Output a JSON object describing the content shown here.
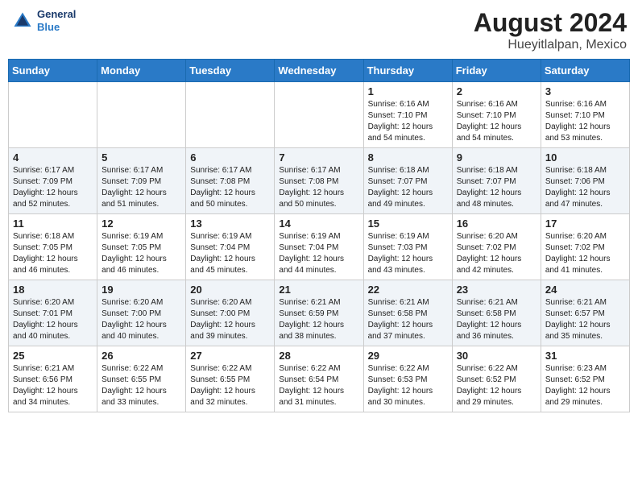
{
  "header": {
    "logo_general": "General",
    "logo_blue": "Blue",
    "title": "August 2024",
    "subtitle": "Hueyitlalpan, Mexico"
  },
  "days_of_week": [
    "Sunday",
    "Monday",
    "Tuesday",
    "Wednesday",
    "Thursday",
    "Friday",
    "Saturday"
  ],
  "weeks": [
    [
      {
        "day": "",
        "info": ""
      },
      {
        "day": "",
        "info": ""
      },
      {
        "day": "",
        "info": ""
      },
      {
        "day": "",
        "info": ""
      },
      {
        "day": "1",
        "info": "Sunrise: 6:16 AM\nSunset: 7:10 PM\nDaylight: 12 hours\nand 54 minutes."
      },
      {
        "day": "2",
        "info": "Sunrise: 6:16 AM\nSunset: 7:10 PM\nDaylight: 12 hours\nand 54 minutes."
      },
      {
        "day": "3",
        "info": "Sunrise: 6:16 AM\nSunset: 7:10 PM\nDaylight: 12 hours\nand 53 minutes."
      }
    ],
    [
      {
        "day": "4",
        "info": "Sunrise: 6:17 AM\nSunset: 7:09 PM\nDaylight: 12 hours\nand 52 minutes."
      },
      {
        "day": "5",
        "info": "Sunrise: 6:17 AM\nSunset: 7:09 PM\nDaylight: 12 hours\nand 51 minutes."
      },
      {
        "day": "6",
        "info": "Sunrise: 6:17 AM\nSunset: 7:08 PM\nDaylight: 12 hours\nand 50 minutes."
      },
      {
        "day": "7",
        "info": "Sunrise: 6:17 AM\nSunset: 7:08 PM\nDaylight: 12 hours\nand 50 minutes."
      },
      {
        "day": "8",
        "info": "Sunrise: 6:18 AM\nSunset: 7:07 PM\nDaylight: 12 hours\nand 49 minutes."
      },
      {
        "day": "9",
        "info": "Sunrise: 6:18 AM\nSunset: 7:07 PM\nDaylight: 12 hours\nand 48 minutes."
      },
      {
        "day": "10",
        "info": "Sunrise: 6:18 AM\nSunset: 7:06 PM\nDaylight: 12 hours\nand 47 minutes."
      }
    ],
    [
      {
        "day": "11",
        "info": "Sunrise: 6:18 AM\nSunset: 7:05 PM\nDaylight: 12 hours\nand 46 minutes."
      },
      {
        "day": "12",
        "info": "Sunrise: 6:19 AM\nSunset: 7:05 PM\nDaylight: 12 hours\nand 46 minutes."
      },
      {
        "day": "13",
        "info": "Sunrise: 6:19 AM\nSunset: 7:04 PM\nDaylight: 12 hours\nand 45 minutes."
      },
      {
        "day": "14",
        "info": "Sunrise: 6:19 AM\nSunset: 7:04 PM\nDaylight: 12 hours\nand 44 minutes."
      },
      {
        "day": "15",
        "info": "Sunrise: 6:19 AM\nSunset: 7:03 PM\nDaylight: 12 hours\nand 43 minutes."
      },
      {
        "day": "16",
        "info": "Sunrise: 6:20 AM\nSunset: 7:02 PM\nDaylight: 12 hours\nand 42 minutes."
      },
      {
        "day": "17",
        "info": "Sunrise: 6:20 AM\nSunset: 7:02 PM\nDaylight: 12 hours\nand 41 minutes."
      }
    ],
    [
      {
        "day": "18",
        "info": "Sunrise: 6:20 AM\nSunset: 7:01 PM\nDaylight: 12 hours\nand 40 minutes."
      },
      {
        "day": "19",
        "info": "Sunrise: 6:20 AM\nSunset: 7:00 PM\nDaylight: 12 hours\nand 40 minutes."
      },
      {
        "day": "20",
        "info": "Sunrise: 6:20 AM\nSunset: 7:00 PM\nDaylight: 12 hours\nand 39 minutes."
      },
      {
        "day": "21",
        "info": "Sunrise: 6:21 AM\nSunset: 6:59 PM\nDaylight: 12 hours\nand 38 minutes."
      },
      {
        "day": "22",
        "info": "Sunrise: 6:21 AM\nSunset: 6:58 PM\nDaylight: 12 hours\nand 37 minutes."
      },
      {
        "day": "23",
        "info": "Sunrise: 6:21 AM\nSunset: 6:58 PM\nDaylight: 12 hours\nand 36 minutes."
      },
      {
        "day": "24",
        "info": "Sunrise: 6:21 AM\nSunset: 6:57 PM\nDaylight: 12 hours\nand 35 minutes."
      }
    ],
    [
      {
        "day": "25",
        "info": "Sunrise: 6:21 AM\nSunset: 6:56 PM\nDaylight: 12 hours\nand 34 minutes."
      },
      {
        "day": "26",
        "info": "Sunrise: 6:22 AM\nSunset: 6:55 PM\nDaylight: 12 hours\nand 33 minutes."
      },
      {
        "day": "27",
        "info": "Sunrise: 6:22 AM\nSunset: 6:55 PM\nDaylight: 12 hours\nand 32 minutes."
      },
      {
        "day": "28",
        "info": "Sunrise: 6:22 AM\nSunset: 6:54 PM\nDaylight: 12 hours\nand 31 minutes."
      },
      {
        "day": "29",
        "info": "Sunrise: 6:22 AM\nSunset: 6:53 PM\nDaylight: 12 hours\nand 30 minutes."
      },
      {
        "day": "30",
        "info": "Sunrise: 6:22 AM\nSunset: 6:52 PM\nDaylight: 12 hours\nand 29 minutes."
      },
      {
        "day": "31",
        "info": "Sunrise: 6:23 AM\nSunset: 6:52 PM\nDaylight: 12 hours\nand 29 minutes."
      }
    ]
  ]
}
